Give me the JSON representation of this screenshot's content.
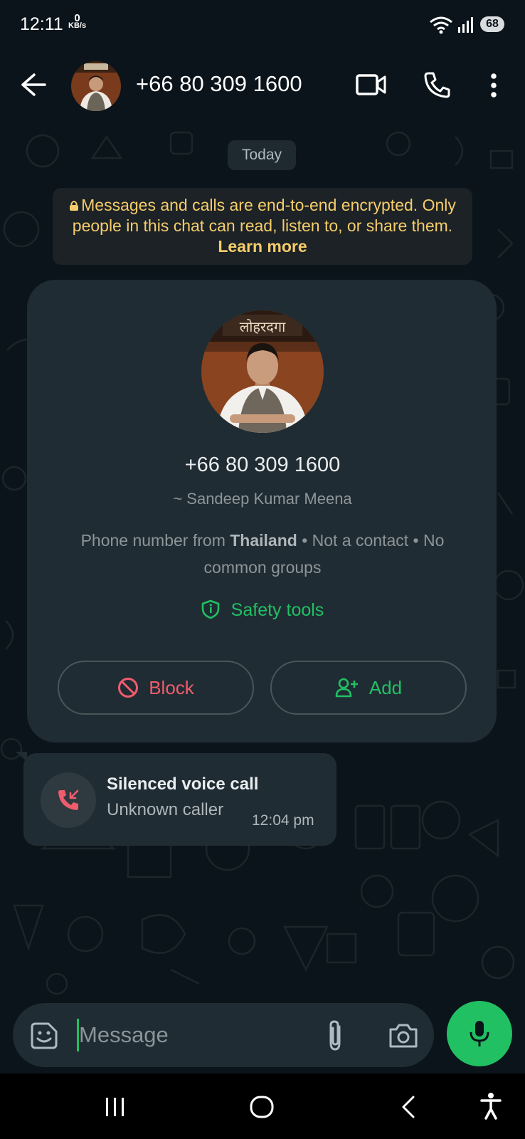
{
  "status_bar": {
    "time": "12:11",
    "net_speed_value": "0",
    "net_speed_unit": "KB/s",
    "battery": "68"
  },
  "header": {
    "title": "+66 80 309 1600"
  },
  "chat": {
    "date_chip": "Today",
    "encryption": {
      "text": "Messages and calls are end-to-end encrypted. Only people in this chat can read, listen to, or share them.",
      "learn_more": "Learn more"
    },
    "profile_card": {
      "phone": "+66 80 309 1600",
      "name": "~ Sandeep Kumar Meena",
      "info_prefix": "Phone number from",
      "country": "Thailand",
      "info_suffix": "• Not a contact • No common groups",
      "safety_tools": "Safety tools",
      "block_label": "Block",
      "add_label": "Add"
    },
    "call_message": {
      "title": "Silenced voice call",
      "subtitle": "Unknown caller",
      "time": "12:04 pm"
    }
  },
  "composer": {
    "placeholder": "Message"
  },
  "colors": {
    "background": "#0b141a",
    "accent_green": "#21c063",
    "danger_red": "#f15c6d",
    "encryption_yellow": "#f7cd6b",
    "bubble": "#202c33"
  },
  "icons": {
    "back": "arrow-left-icon",
    "video_call": "video-camera-icon",
    "voice_call": "phone-icon",
    "menu": "more-vertical-icon",
    "lock": "lock-icon",
    "safety": "shield-icon",
    "block": "block-icon",
    "add_contact": "person-add-icon",
    "missed_call": "missed-call-icon",
    "emoji": "sticker-icon",
    "attach": "paperclip-icon",
    "camera": "camera-icon",
    "mic": "mic-icon"
  }
}
